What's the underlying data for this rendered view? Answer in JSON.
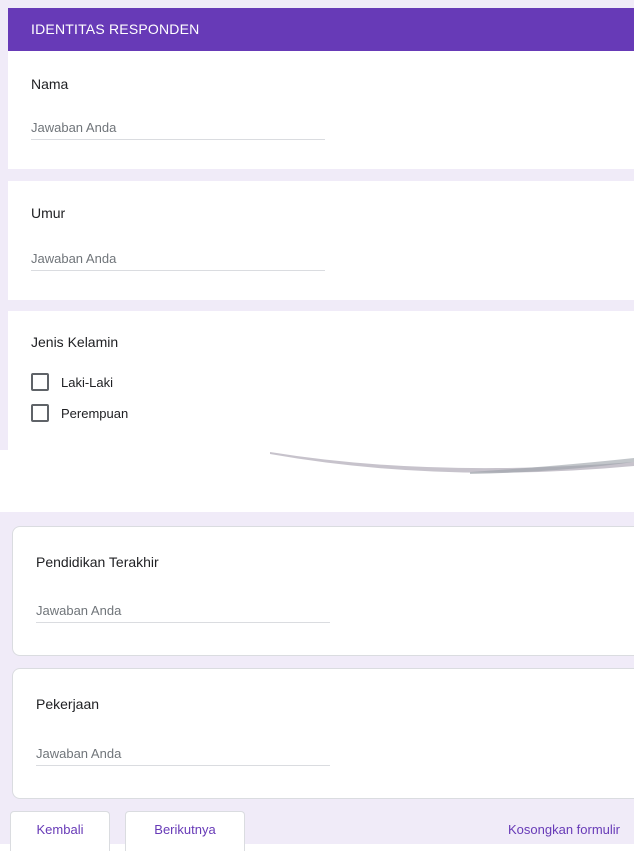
{
  "section": {
    "title": "IDENTITAS RESPONDEN"
  },
  "questions": {
    "nama": {
      "title": "Nama",
      "placeholder": "Jawaban Anda"
    },
    "umur": {
      "title": "Umur",
      "placeholder": "Jawaban Anda"
    },
    "jenis_kelamin": {
      "title": "Jenis Kelamin",
      "options": [
        {
          "label": "Laki-Laki",
          "checked": false
        },
        {
          "label": "Perempuan",
          "checked": false
        }
      ]
    },
    "pendidikan": {
      "title": "Pendidikan Terakhir",
      "placeholder": "Jawaban Anda"
    },
    "pekerjaan": {
      "title": "Pekerjaan",
      "placeholder": "Jawaban Anda"
    }
  },
  "footer": {
    "back_label": "Kembali",
    "next_label": "Berikutnya",
    "clear_label": "Kosongkan formulir"
  },
  "colors": {
    "accent": "#673ab7",
    "background": "#f0ebf8",
    "placeholder": "#70757a"
  }
}
